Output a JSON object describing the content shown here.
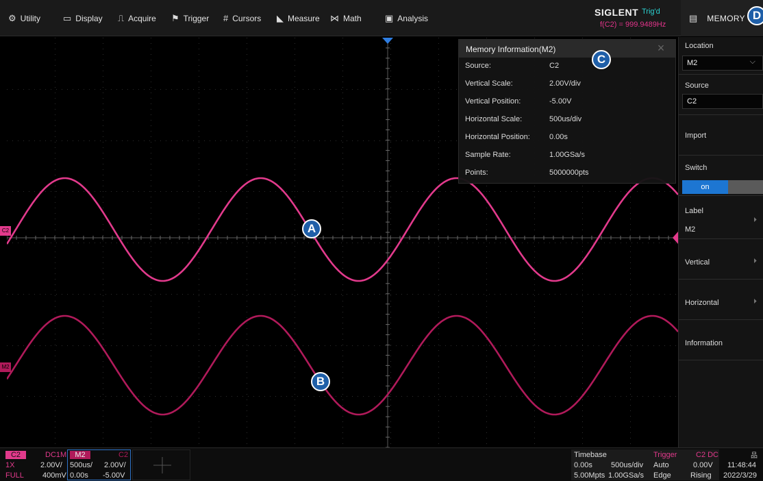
{
  "menu": {
    "items": [
      {
        "label": "Utility",
        "icon": "gear-icon"
      },
      {
        "label": "Display",
        "icon": "monitor-icon"
      },
      {
        "label": "Acquire",
        "icon": "acquire-icon"
      },
      {
        "label": "Trigger",
        "icon": "flag-icon"
      },
      {
        "label": "Cursors",
        "icon": "cursors-icon"
      },
      {
        "label": "Measure",
        "icon": "measure-icon"
      },
      {
        "label": "Math",
        "icon": "math-icon"
      },
      {
        "label": "Analysis",
        "icon": "analysis-icon"
      }
    ],
    "brand": "SIGLENT",
    "trigger_status": "Trig'd",
    "frequency": "f(C2) = 999.9489Hz",
    "right_title": "MEMORY"
  },
  "callouts": {
    "a": "A",
    "b": "B",
    "c": "C",
    "d": "D"
  },
  "channels": {
    "c2_marker": "C2",
    "m2_marker": "M2"
  },
  "memory_info": {
    "title": "Memory Information(M2)",
    "close": "×",
    "rows": [
      {
        "key": "Source:",
        "value": "C2"
      },
      {
        "key": "Vertical Scale:",
        "value": "2.00V/div"
      },
      {
        "key": "Vertical Position:",
        "value": "-5.00V"
      },
      {
        "key": "Horizontal Scale:",
        "value": "500us/div"
      },
      {
        "key": "Horizontal Position:",
        "value": "0.00s"
      },
      {
        "key": "Sample Rate:",
        "value": "1.00GSa/s"
      },
      {
        "key": "Points:",
        "value": "5000000pts"
      }
    ]
  },
  "panel": {
    "location_label": "Location",
    "location_value": "M2",
    "source_label": "Source",
    "source_value": "C2",
    "import_label": "Import",
    "switch_label": "Switch",
    "switch_state": "on",
    "label_label": "Label",
    "label_value": "M2",
    "vertical_label": "Vertical",
    "horizontal_label": "Horizontal",
    "information_label": "Information"
  },
  "bottom": {
    "c2": {
      "name": "C2",
      "coupling": "DC1M",
      "ratio": "1X",
      "scale": "2.00V/",
      "bw": "FULL",
      "offset": "400mV"
    },
    "m2": {
      "name": "M2",
      "source": "C2",
      "hscale": "500us/",
      "vscale": "2.00V/",
      "hpos": "0.00s",
      "vpos": "-5.00V"
    },
    "timebase": {
      "label": "Timebase",
      "delay": "0.00s",
      "scale": "500us/div",
      "points": "5.00Mpts",
      "rate": "1.00GSa/s"
    },
    "trigger": {
      "label": "Trigger",
      "source": "C2 DC",
      "mode": "Auto",
      "level": "0.00V",
      "type": "Edge",
      "slope": "Rising"
    },
    "time": "11:48:44",
    "date": "2022/3/29"
  },
  "colors": {
    "c2": "#e23a8c",
    "m2": "#b01a5a",
    "accent": "#1d76d2"
  }
}
